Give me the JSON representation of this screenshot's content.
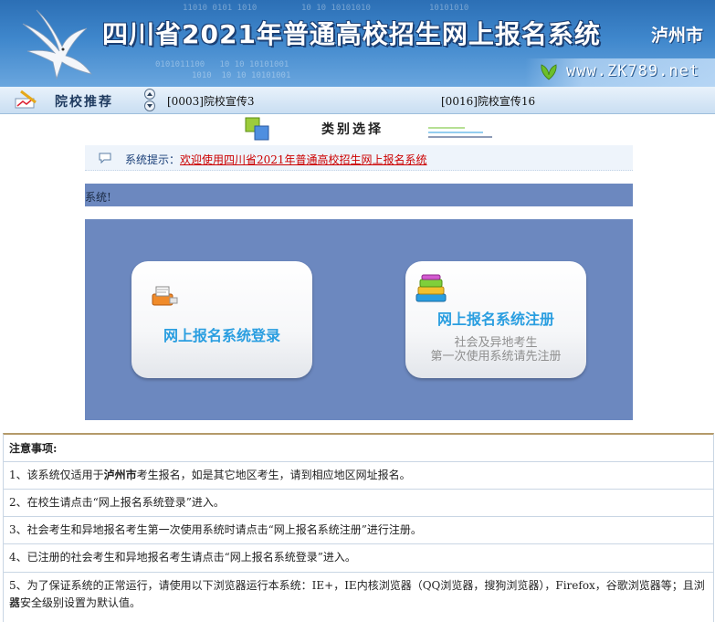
{
  "header": {
    "title": "四川省2021年普通高校招生网上报名系统",
    "city": "泸州市",
    "url": "www.ZK789.net",
    "bits": [
      "11010 0101 1010",
      "10 10 10101010",
      "0101011100   10 10 10101001",
      "1010  10 10 10101001",
      "10101010"
    ]
  },
  "nav": {
    "label": "院校推荐",
    "promos": [
      "[0003]院校宣传3",
      "[0016]院校宣传16"
    ]
  },
  "category": {
    "title": "类别选择"
  },
  "notice": {
    "prefix": "系统提示：",
    "message": "欢迎使用四川省2021年普通高校招生网上报名系统",
    "marquee": "系统!"
  },
  "cards": {
    "login": {
      "label": "网上报名系统登录"
    },
    "register": {
      "label": "网上报名系统注册",
      "sub1": "社会及异地考生",
      "sub2": "第一次使用系统请先注册"
    }
  },
  "notes": {
    "heading": "注意事项:",
    "items": [
      {
        "before": "1、该系统仅适用于",
        "bold": "泸州市",
        "after": "考生报名，如是其它地区考生，请到相应地区网址报名。"
      },
      "2、在校生请点击“网上报名系统登录”进入。",
      "3、社会考生和异地报名考生第一次使用系统时请点击“网上报名系统注册”进行注册。",
      "4、已注册的社会考生和异地报名考生请点击“网上报名系统登录”进入。",
      {
        "line1": "5、为了保证系统的正常运行，请使用以下浏览器运行本系统：IE+，IE内核浏览器（QQ浏览器，搜狗浏览器），Firefox，谷歌浏览器等；且浏览",
        "line2": "器安全级别设置为默认值。"
      }
    ]
  },
  "colors": {
    "accent": "#2a9ee0",
    "panel": "#6c88bf",
    "alert": "#cc0000"
  }
}
